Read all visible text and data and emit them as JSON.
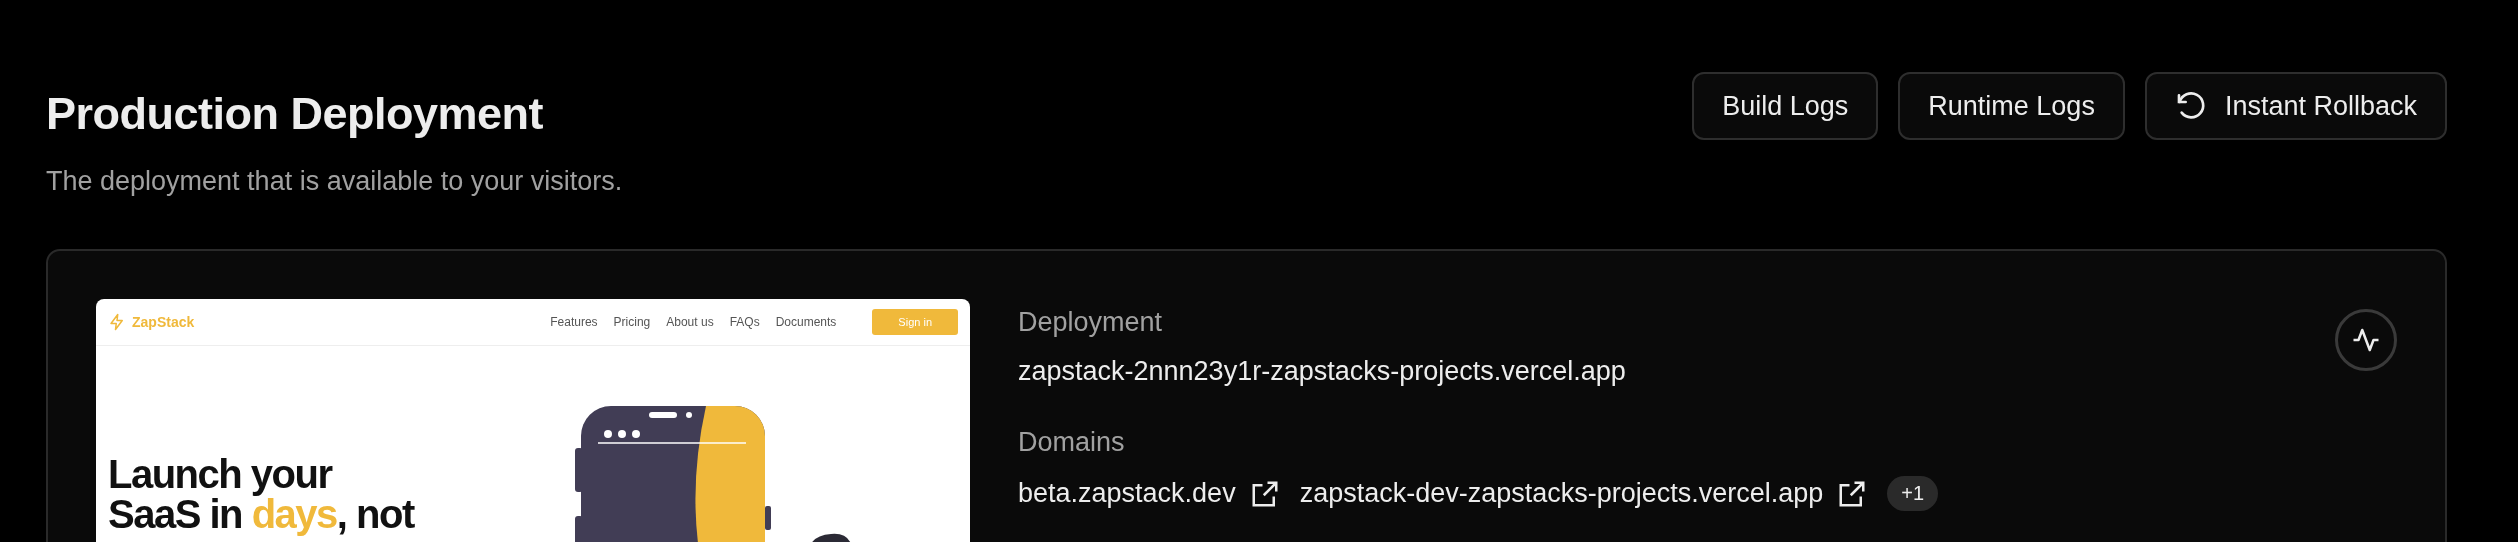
{
  "header": {
    "title": "Production Deployment",
    "subtitle": "The deployment that is available to your visitors.",
    "buttons": [
      {
        "label": "Build Logs",
        "kind": "plain"
      },
      {
        "label": "Runtime Logs",
        "kind": "plain"
      },
      {
        "label": "Instant Rollback",
        "kind": "rollback"
      }
    ]
  },
  "preview": {
    "brand": "ZapStack",
    "nav": [
      "Features",
      "Pricing",
      "About us",
      "FAQs",
      "Documents"
    ],
    "cta": "Sign in",
    "headline": [
      [
        {
          "text": "Launch your",
          "highlight": false
        }
      ],
      [
        {
          "text": "SaaS in ",
          "highlight": false
        },
        {
          "text": "days",
          "highlight": true
        },
        {
          "text": ", not",
          "highlight": false
        }
      ]
    ]
  },
  "details": [
    {
      "label": "Deployment",
      "values": [
        {
          "text": "zapstack-2nnn23y1r-zapstacks-projects.vercel.app",
          "external": false
        }
      ]
    },
    {
      "label": "Domains",
      "values": [
        {
          "text": "beta.zapstack.dev",
          "external": true
        },
        {
          "text": "zapstack-dev-zapstacks-projects.vercel.app",
          "external": true
        }
      ],
      "more": "+1"
    }
  ]
}
